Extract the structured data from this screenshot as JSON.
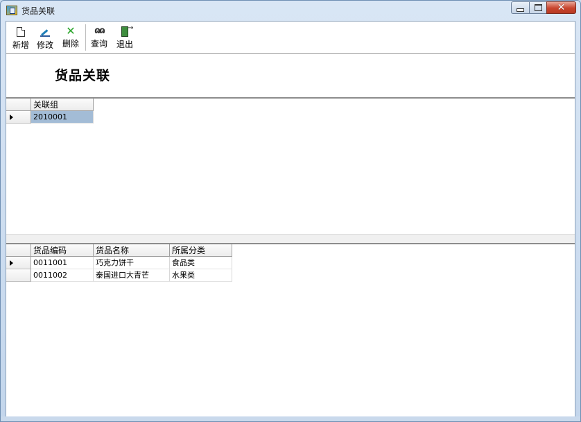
{
  "window": {
    "title": "货品关联",
    "icon": "app-icon",
    "caption_buttons": [
      "minimize-icon",
      "maximize-icon",
      "close-icon"
    ]
  },
  "toolbar": {
    "items": [
      {
        "label": "新增",
        "icon": "new-document-icon"
      },
      {
        "label": "修改",
        "icon": "edit-icon"
      },
      {
        "label": "删除",
        "icon": "delete-icon"
      },
      {
        "label": "查询",
        "icon": "binoculars-icon"
      },
      {
        "label": "退出",
        "icon": "exit-door-icon"
      }
    ]
  },
  "page": {
    "heading": "货品关联"
  },
  "group_grid": {
    "columns": [
      "关联组"
    ],
    "rows": [
      {
        "group": "2010001",
        "current": true,
        "selected": true
      }
    ]
  },
  "goods_grid": {
    "columns": [
      "货品编码",
      "货品名称",
      "所属分类"
    ],
    "rows": [
      {
        "code": "0011001",
        "name": "巧克力饼干",
        "category": "食品类",
        "current": true
      },
      {
        "code": "0011002",
        "name": "泰国进口大青芒",
        "category": "水果类",
        "current": false
      }
    ]
  },
  "colors": {
    "selected_cell": "#a3bcd6",
    "close_button": "#c8442d",
    "delete_icon": "#2aa52a"
  }
}
